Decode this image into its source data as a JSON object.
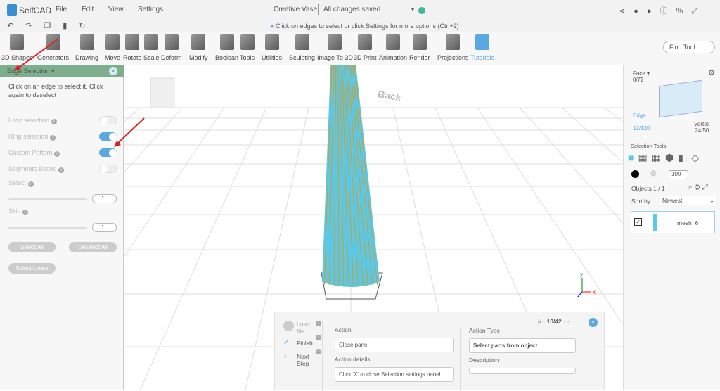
{
  "app": {
    "logo": "SelfCAD",
    "project": "Creative Vase",
    "save_status": "All changes saved"
  },
  "menu": [
    "File",
    "Edit",
    "View",
    "Settings"
  ],
  "hint": "Click on edges to select or click Settings for more options (Ctrl+2)",
  "tools": [
    "3D Shapes",
    "Generators",
    "Drawing",
    "Move",
    "Rotate",
    "Scale",
    "Deform",
    "Modify",
    "Boolean",
    "Tools",
    "Utilities",
    "Sculpting",
    "Image To 3D",
    "3D Print",
    "Animation",
    "Render",
    "Projections",
    "Tutorials"
  ],
  "find_tool": "Find Tool",
  "left_panel": {
    "title": "Edge Selection",
    "description": "Click on an edge to select it. Click again to deselect",
    "options": [
      {
        "label": "Loop selection",
        "on": false
      },
      {
        "label": "Ring selection",
        "on": true
      },
      {
        "label": "Custom Pattern",
        "on": true
      },
      {
        "label": "Segments Based",
        "on": false
      }
    ],
    "select_label": "Select",
    "select_value": "1",
    "skip_label": "Skip",
    "skip_value": "1",
    "select_all": "Select All",
    "deselect_all": "Deselect All",
    "select_loose": "Select Loose"
  },
  "viewport": {
    "back_label": "Back",
    "accent": "#5bc8e8",
    "edge_color": "#c8a030"
  },
  "right_panel": {
    "face_label": "Face",
    "face_count": "0/72",
    "edge_label": "Edge",
    "edge_count": "12/120",
    "vertex_label": "Vertex",
    "vertex_count": "24/50",
    "selection_tools": "Selection Tools",
    "opacity": "100",
    "objects": "Objects 1 / 1",
    "sort_by": "Sort by",
    "sort_value": "Newest",
    "object_name": "mesh_6"
  },
  "tutorial": {
    "steps": [
      "Load file",
      "Finish",
      "Next Step"
    ],
    "pager": "10/42",
    "action_label": "Action",
    "action_value": "Close panel",
    "details_label": "Action details",
    "details_value": "Click 'X' to close Selection settings panel.",
    "type_label": "Action Type",
    "type_value": "Select parts from object",
    "description_label": "Description",
    "description_value": ""
  }
}
